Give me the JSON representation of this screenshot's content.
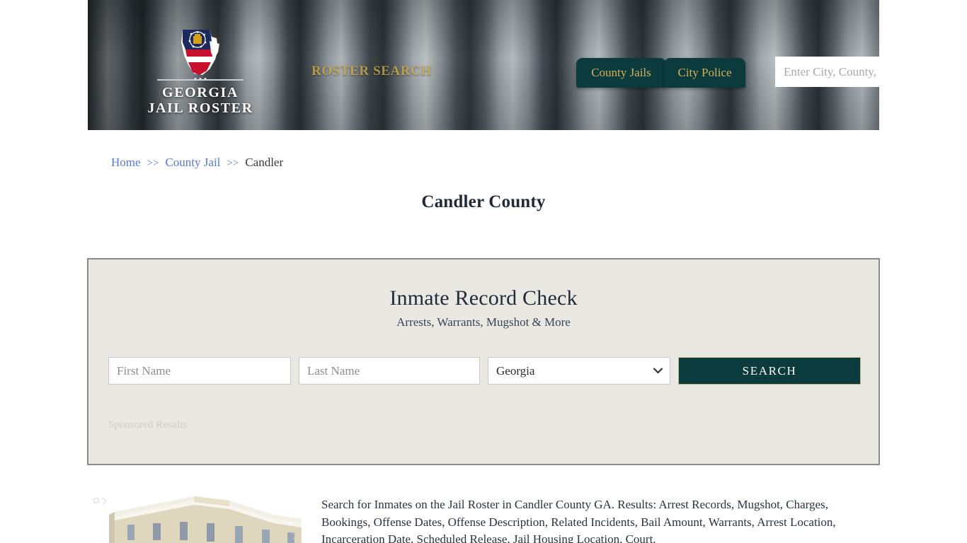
{
  "header": {
    "logo": {
      "line1": "GEORGIA",
      "line2": "JAIL ROSTER",
      "icon": "georgia-state-flag-icon"
    },
    "tagline": "ROSTER SEARCH",
    "nav": [
      {
        "label": "County Jails",
        "name": "county-jails"
      },
      {
        "label": "City Police",
        "name": "city-police"
      }
    ],
    "search": {
      "placeholder": "Enter City, County, or Facility",
      "value": "",
      "icon": "search-icon"
    },
    "colors": {
      "button_bg": "#0b3b3d",
      "button_text": "#d2b15a",
      "tagline": "#c8a94a"
    }
  },
  "breadcrumb": {
    "items": [
      {
        "label": "Home",
        "link": true
      },
      {
        "label": "County Jail",
        "link": true
      },
      {
        "label": "Candler",
        "link": false
      }
    ],
    "separator": ">>"
  },
  "page": {
    "title": "Candler County"
  },
  "panel": {
    "title": "Inmate Record Check",
    "subtitle": "Arrests, Warrants, Mugshot & More",
    "sponsored_label": "Sponsored Results",
    "form": {
      "first_name": {
        "placeholder": "First Name",
        "value": ""
      },
      "last_name": {
        "placeholder": "Last Name",
        "value": ""
      },
      "state": {
        "selected": "Georgia",
        "options": [
          "Georgia"
        ]
      },
      "submit_label": "SEARCH"
    },
    "colors": {
      "panel_bg": "#e9e8e3",
      "panel_border": "#8a8a8a",
      "submit_bg": "#0b3b3d",
      "submit_border": "#c6b98b"
    }
  },
  "content": {
    "image_alt": "candler-county-jail-building",
    "paragraph": "Search for Inmates on the Jail Roster in Candler County GA. Results: Arrest Records, Mugshot, Charges, Bookings, Offense Dates, Offense Description, Related Incidents, Bail Amount, Warrants, Arrest Location, Incarceration Date, Scheduled Release, Jail Housing Location, Court."
  }
}
